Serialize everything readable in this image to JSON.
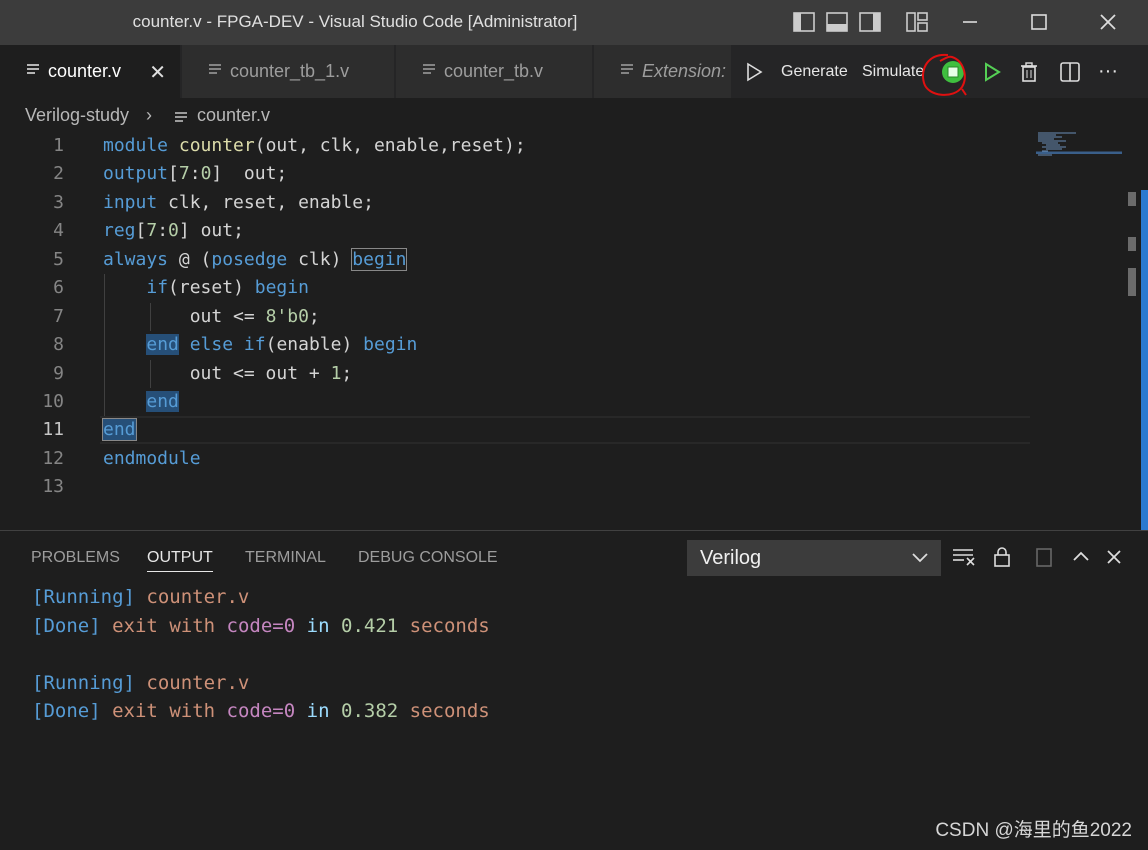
{
  "window": {
    "title": "counter.v - FPGA-DEV - Visual Studio Code [Administrator]"
  },
  "tabs": [
    {
      "label": "counter.v",
      "active": true,
      "icon": "file-lines-icon"
    },
    {
      "label": "counter_tb_1.v",
      "active": false,
      "icon": "file-lines-icon"
    },
    {
      "label": "counter_tb.v",
      "active": false,
      "icon": "file-lines-icon"
    },
    {
      "label": "Extension:",
      "active": false,
      "icon": "file-lines-icon"
    }
  ],
  "editor_actions": {
    "generate_label": "Generate",
    "simulate_label": "Simulate"
  },
  "breadcrumb": {
    "folder": "Verilog-study",
    "file": "counter.v"
  },
  "editor": {
    "line_numbers": [
      "1",
      "2",
      "3",
      "4",
      "5",
      "6",
      "7",
      "8",
      "9",
      "10",
      "11",
      "12",
      "13"
    ],
    "current_line": "11"
  },
  "panel": {
    "tabs": [
      "PROBLEMS",
      "OUTPUT",
      "TERMINAL",
      "DEBUG CONSOLE"
    ],
    "active_tab": "OUTPUT",
    "channel": "Verilog",
    "output": [
      {
        "tag": "[Running]",
        "text": "counter.v"
      },
      {
        "tag": "[Done]",
        "w1": "exit",
        "w2": "with",
        "kv": "code",
        "eq": "=",
        "code": "0",
        "w3": "in",
        "time": "0.421",
        "unit": "seconds"
      },
      {
        "tag": "[Running]",
        "text": "counter.v"
      },
      {
        "tag": "[Done]",
        "w1": "exit",
        "w2": "with",
        "kv": "code",
        "eq": "=",
        "code": "0",
        "w3": "in",
        "time": "0.382",
        "unit": "seconds"
      }
    ]
  },
  "watermark": "CSDN @海里的鱼2022",
  "colors": {
    "keyword": "#569cd6",
    "type": "#4ec9b0",
    "number": "#b5cea8",
    "string_orange": "#ce9178",
    "annotation_red": "#e01010"
  }
}
